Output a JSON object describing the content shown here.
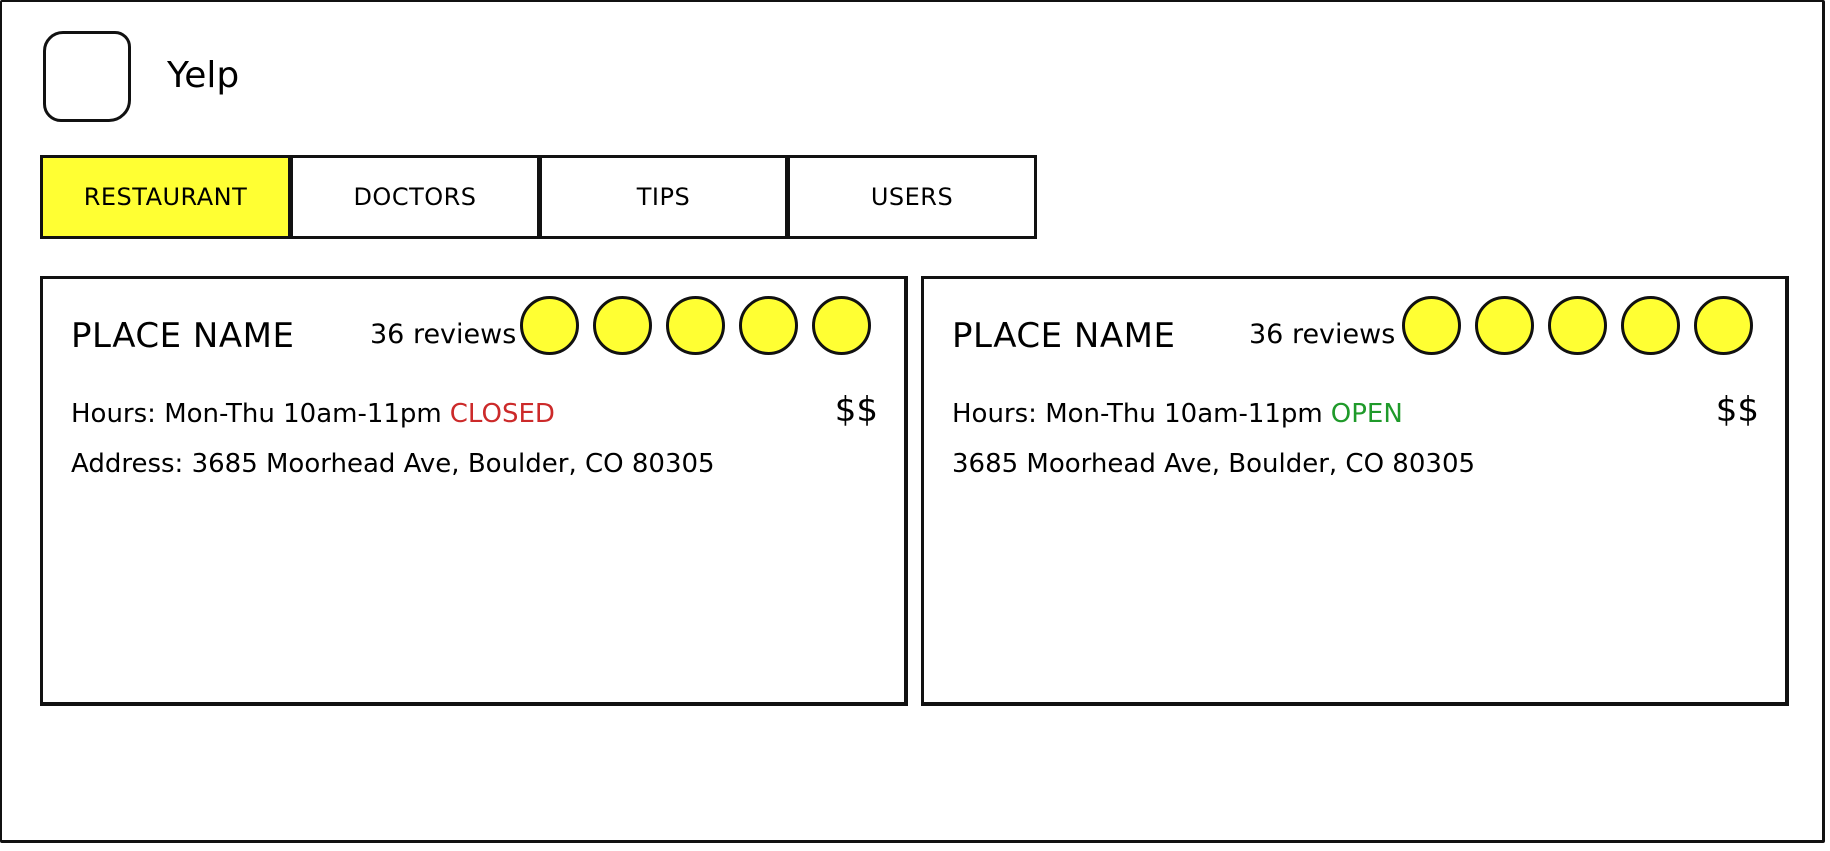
{
  "app": {
    "title": "Yelp"
  },
  "tabs": [
    {
      "label": "RESTAURANT",
      "active": true
    },
    {
      "label": "DOCTORS",
      "active": false
    },
    {
      "label": "TIPS",
      "active": false
    },
    {
      "label": "USERS",
      "active": false
    }
  ],
  "cards": [
    {
      "place_name": "PLACE NAME",
      "reviews": "36 reviews",
      "rating": 5,
      "price": "$$",
      "hours": "Hours: Mon-Thu 10am-11pm",
      "status": "CLOSED",
      "address": "Address: 3685 Moorhead Ave, Boulder, CO 80305"
    },
    {
      "place_name": "PLACE NAME",
      "reviews": "36 reviews",
      "rating": 5,
      "price": "$$",
      "hours": "Hours: Mon-Thu 10am-11pm",
      "status": "OPEN",
      "address": "3685 Moorhead Ave, Boulder, CO 80305"
    }
  ],
  "colors": {
    "accent": "#ffff33",
    "closed": "#cc2a2a",
    "open": "#1f9a2a"
  }
}
